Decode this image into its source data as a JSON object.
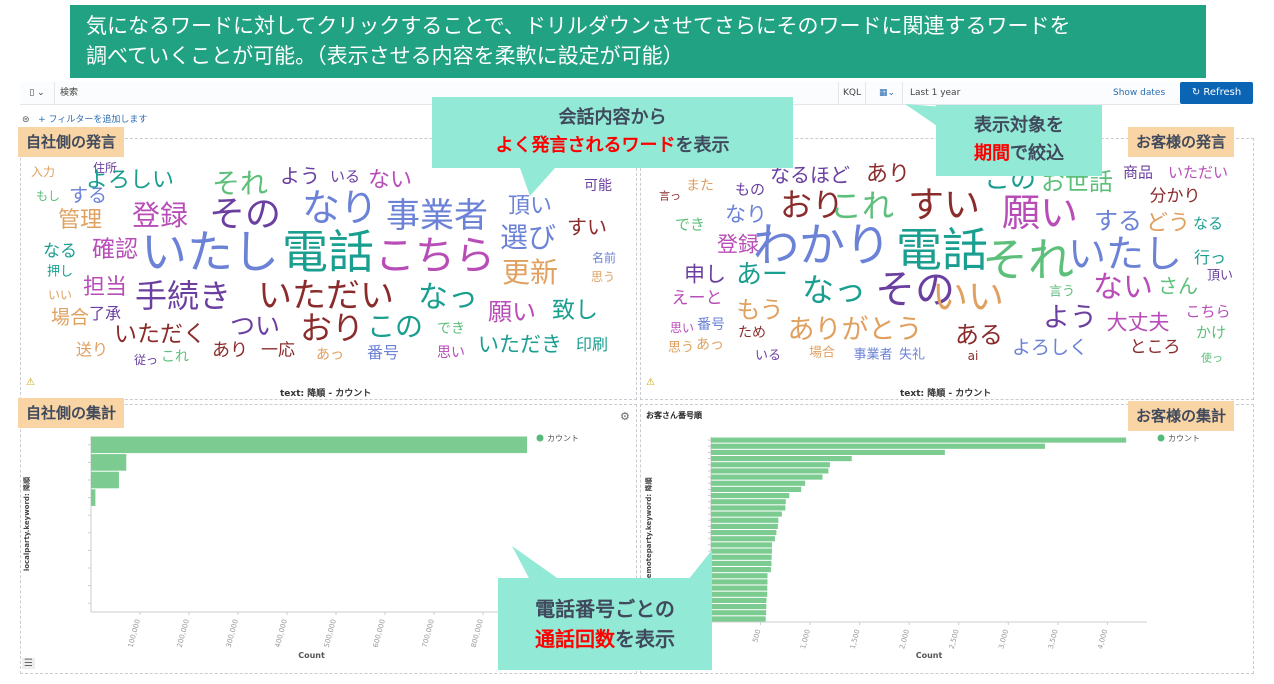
{
  "banner": {
    "line1": "気になるワードに対してクリックすることで、ドリルダウンさせてさらにそのワードに関連するワードを",
    "line2": "調べていくことが可能。（表示させる内容を柔軟に設定が可能）"
  },
  "query": {
    "search_placeholder": "検索",
    "kql": "KQL",
    "date_range": "Last 1 year",
    "show_dates": "Show dates",
    "refresh": "Refresh",
    "add_filter": "+ フィルターを追加します"
  },
  "labels": {
    "own_speech": "自社側の発言",
    "customer_speech": "お客様の発言",
    "own_summary": "自社側の集計",
    "customer_summary": "お客様の集計"
  },
  "callouts": {
    "c1_line1": "会話内容から",
    "c1_red": "よく発言されるワード",
    "c1_rest": "を表示",
    "c2_line1": "表示対象を",
    "c2_red": "期間",
    "c2_rest": "で絞込",
    "c3_line1": "電話番号ごとの",
    "c3_red": "通話回数",
    "c3_rest": "を表示"
  },
  "wordcloud_left": {
    "caption": "text: 降順 - カウント",
    "words": [
      {
        "t": "入力",
        "c": "#e0a060"
      },
      {
        "t": "住所",
        "c": "#6b3fa0"
      },
      {
        "t": "よろしい",
        "c": "#1a9e8f"
      },
      {
        "t": "それ",
        "c": "#5cbf7a"
      },
      {
        "t": "よう",
        "c": "#6b3fa0"
      },
      {
        "t": "いる",
        "c": "#6b3fa0"
      },
      {
        "t": "ない",
        "c": "#b84db8"
      },
      {
        "t": "可能",
        "c": "#6b3fa0"
      },
      {
        "t": "もし",
        "c": "#5cbf7a"
      },
      {
        "t": "する",
        "c": "#6b82d6"
      },
      {
        "t": "管理",
        "c": "#e0a060"
      },
      {
        "t": "登録",
        "c": "#b84db8"
      },
      {
        "t": "その",
        "c": "#6b3fa0"
      },
      {
        "t": "なり",
        "c": "#6b82d6"
      },
      {
        "t": "事業者",
        "c": "#6b82d6"
      },
      {
        "t": "頂い",
        "c": "#6b82d6"
      },
      {
        "t": "すい",
        "c": "#8b2c2c"
      },
      {
        "t": "選び",
        "c": "#6b82d6"
      },
      {
        "t": "なる",
        "c": "#1a9e8f"
      },
      {
        "t": "確認",
        "c": "#b84db8"
      },
      {
        "t": "いたし",
        "c": "#6b82d6"
      },
      {
        "t": "電話",
        "c": "#1a9e8f"
      },
      {
        "t": "こちら",
        "c": "#b84db8"
      },
      {
        "t": "名前",
        "c": "#6b82d6"
      },
      {
        "t": "更新",
        "c": "#e0a060"
      },
      {
        "t": "押し",
        "c": "#1a9e8f"
      },
      {
        "t": "思う",
        "c": "#e0a060"
      },
      {
        "t": "担当",
        "c": "#b84db8"
      },
      {
        "t": "いい",
        "c": "#e0a060"
      },
      {
        "t": "手続き",
        "c": "#6b3fa0"
      },
      {
        "t": "いただい",
        "c": "#8b2c2c"
      },
      {
        "t": "なっ",
        "c": "#1a9e8f"
      },
      {
        "t": "願い",
        "c": "#b84db8"
      },
      {
        "t": "致し",
        "c": "#1a9e8f"
      },
      {
        "t": "場合",
        "c": "#e0a060"
      },
      {
        "t": "了承",
        "c": "#6b3fa0"
      },
      {
        "t": "つい",
        "c": "#6b3fa0"
      },
      {
        "t": "おり",
        "c": "#8b2c2c"
      },
      {
        "t": "この",
        "c": "#1a9e8f"
      },
      {
        "t": "でき",
        "c": "#5cbf7a"
      },
      {
        "t": "いただく",
        "c": "#8b2c2c"
      },
      {
        "t": "いただき",
        "c": "#1a9e8f"
      },
      {
        "t": "印刷",
        "c": "#1a9e8f"
      },
      {
        "t": "送り",
        "c": "#e0a060"
      },
      {
        "t": "あり",
        "c": "#8b2c2c"
      },
      {
        "t": "一応",
        "c": "#8b2c2c"
      },
      {
        "t": "あっ",
        "c": "#e0a060"
      },
      {
        "t": "番号",
        "c": "#6b82d6"
      },
      {
        "t": "思い",
        "c": "#b84db8"
      },
      {
        "t": "従っ",
        "c": "#6b3fa0"
      },
      {
        "t": "これ",
        "c": "#5cbf7a"
      }
    ]
  },
  "wordcloud_right": {
    "caption": "text: 降順 - カウント",
    "words": [
      {
        "t": "言っ",
        "c": "#8b2c2c"
      },
      {
        "t": "また",
        "c": "#e0a060"
      },
      {
        "t": "もの",
        "c": "#6b3fa0"
      },
      {
        "t": "なるほど",
        "c": "#6b3fa0"
      },
      {
        "t": "あり",
        "c": "#8b2c2c"
      },
      {
        "t": "この",
        "c": "#1a9e8f"
      },
      {
        "t": "お世話",
        "c": "#5cbf7a"
      },
      {
        "t": "商品",
        "c": "#6b3fa0"
      },
      {
        "t": "いただい",
        "c": "#b84db8"
      },
      {
        "t": "分かり",
        "c": "#8b2c2c"
      },
      {
        "t": "なり",
        "c": "#6b82d6"
      },
      {
        "t": "おり",
        "c": "#8b2c2c"
      },
      {
        "t": "これ",
        "c": "#5cbf7a"
      },
      {
        "t": "すい",
        "c": "#8b2c2c"
      },
      {
        "t": "願い",
        "c": "#b84db8"
      },
      {
        "t": "する",
        "c": "#6b82d6"
      },
      {
        "t": "どう",
        "c": "#e0a060"
      },
      {
        "t": "なる",
        "c": "#1a9e8f"
      },
      {
        "t": "でき",
        "c": "#5cbf7a"
      },
      {
        "t": "登録",
        "c": "#b84db8"
      },
      {
        "t": "わかり",
        "c": "#6b82d6"
      },
      {
        "t": "電話",
        "c": "#1a9e8f"
      },
      {
        "t": "それ",
        "c": "#5cbf7a"
      },
      {
        "t": "いたし",
        "c": "#6b82d6"
      },
      {
        "t": "行っ",
        "c": "#1a9e8f"
      },
      {
        "t": "申し",
        "c": "#6b3fa0"
      },
      {
        "t": "あー",
        "c": "#1a9e8f"
      },
      {
        "t": "頂い",
        "c": "#6b3fa0"
      },
      {
        "t": "なっ",
        "c": "#1a9e8f"
      },
      {
        "t": "その",
        "c": "#6b3fa0"
      },
      {
        "t": "いい",
        "c": "#e0a060"
      },
      {
        "t": "ない",
        "c": "#b84db8"
      },
      {
        "t": "さん",
        "c": "#5cbf7a"
      },
      {
        "t": "言う",
        "c": "#5cbf7a"
      },
      {
        "t": "えーと",
        "c": "#b84db8"
      },
      {
        "t": "もう",
        "c": "#e0a060"
      },
      {
        "t": "よう",
        "c": "#6b3fa0"
      },
      {
        "t": "大丈夫",
        "c": "#b84db8"
      },
      {
        "t": "こちら",
        "c": "#b84db8"
      },
      {
        "t": "思い",
        "c": "#b84db8"
      },
      {
        "t": "番号",
        "c": "#6b82d6"
      },
      {
        "t": "ため",
        "c": "#8b2c2c"
      },
      {
        "t": "ありがとう",
        "c": "#e0a060"
      },
      {
        "t": "ある",
        "c": "#8b2c2c"
      },
      {
        "t": "かけ",
        "c": "#5cbf7a"
      },
      {
        "t": "思う",
        "c": "#e0a060"
      },
      {
        "t": "あっ",
        "c": "#e0a060"
      },
      {
        "t": "よろしく",
        "c": "#6b82d6"
      },
      {
        "t": "ところ",
        "c": "#8b2c2c"
      },
      {
        "t": "いる",
        "c": "#6b3fa0"
      },
      {
        "t": "場合",
        "c": "#e0a060"
      },
      {
        "t": "事業者",
        "c": "#6b82d6"
      },
      {
        "t": "失礼",
        "c": "#6b82d6"
      },
      {
        "t": "ai",
        "c": "#8b2c2c"
      },
      {
        "t": "使っ",
        "c": "#5cbf7a"
      }
    ]
  },
  "chart_data": [
    {
      "type": "bar",
      "orientation": "horizontal",
      "title": "",
      "xlabel": "Count",
      "ylabel": "localparty.keyword: 降順",
      "legend": [
        "カウント"
      ],
      "legend_position": "top-right",
      "color": "#7ccc92",
      "xlim": [
        0,
        900000
      ],
      "xticks": [
        "100,000",
        "200,000",
        "300,000",
        "400,000",
        "500,000",
        "600,000",
        "700,000",
        "800,000"
      ],
      "values": [
        890000,
        72000,
        57000,
        9000,
        0,
        0,
        0,
        0,
        0,
        0
      ]
    },
    {
      "type": "bar",
      "orientation": "horizontal",
      "title": "お客さん番号順",
      "xlabel": "Count",
      "ylabel": "remoteparty.keyword: 降順",
      "legend": [
        "カウント"
      ],
      "legend_position": "top-right",
      "color": "#7ccc92",
      "xlim": [
        0,
        4400
      ],
      "xticks": [
        "500",
        "1,000",
        "1,500",
        "2,000",
        "2,500",
        "3,000",
        "3,500",
        "4,000"
      ],
      "values": [
        4190,
        3370,
        2360,
        1420,
        1200,
        1185,
        1125,
        950,
        910,
        790,
        755,
        750,
        715,
        680,
        675,
        660,
        645,
        615,
        615,
        612,
        610,
        605,
        570,
        570,
        568,
        568,
        560,
        558,
        556,
        552
      ]
    }
  ]
}
